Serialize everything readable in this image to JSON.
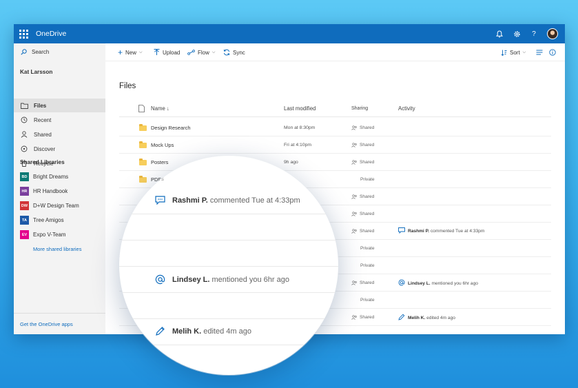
{
  "app": {
    "title": "OneDrive",
    "accent_color": "#0f6cbd",
    "suite_icons": [
      "bell-icon",
      "gear-icon",
      "help-icon",
      "avatar"
    ]
  },
  "sidebar": {
    "search_label": "Search",
    "user_name": "Kat Larsson",
    "nav": [
      {
        "label": "Files",
        "icon": "folder-icon",
        "active": true
      },
      {
        "label": "Recent",
        "icon": "clock-icon",
        "active": false
      },
      {
        "label": "Shared",
        "icon": "person-icon",
        "active": false
      },
      {
        "label": "Discover",
        "icon": "compass-icon",
        "active": false
      },
      {
        "label": "Recycle",
        "icon": "recycle-icon",
        "active": false
      }
    ],
    "libraries_header": "Shared Libraries",
    "libraries": [
      {
        "badge": "BD",
        "label": "Bright Dreams",
        "color": "#0b7a75"
      },
      {
        "badge": "HR",
        "label": "HR Handbook",
        "color": "#7a3e9d"
      },
      {
        "badge": "DW",
        "label": "D+W Design Team",
        "color": "#d13438"
      },
      {
        "badge": "TA",
        "label": "Tree Amigos",
        "color": "#1d5aa8"
      },
      {
        "badge": "EV",
        "label": "Expo V-Team",
        "color": "#e3008c"
      }
    ],
    "more_libraries": "More shared libraries",
    "get_apps": "Get the OneDrive apps"
  },
  "command_bar": {
    "new": "New",
    "upload": "Upload",
    "flow": "Flow",
    "sync": "Sync",
    "sort": "Sort"
  },
  "main": {
    "title": "Files",
    "columns": {
      "name": "Name ↓",
      "modified": "Last modified",
      "sharing": "Sharing",
      "activity": "Activity"
    },
    "rows": [
      {
        "name": "Design Research",
        "modified": "Mon at 8:30pm",
        "sharing": "Shared",
        "activity": null
      },
      {
        "name": "Mock Ups",
        "modified": "Fri at 4:10pm",
        "sharing": "Shared",
        "activity": null
      },
      {
        "name": "Posters",
        "modified": "9h ago",
        "sharing": "Shared",
        "activity": null
      },
      {
        "name": "PDFs",
        "modified": "",
        "sharing": "Private",
        "activity": null
      },
      {
        "name": "",
        "modified": "",
        "sharing": "Shared",
        "activity": null
      },
      {
        "name": "",
        "modified": "",
        "sharing": "Shared",
        "activity": null
      },
      {
        "name": "",
        "modified": "",
        "sharing": "Shared",
        "activity": {
          "icon": "comment-icon",
          "user": "Rashmi P.",
          "text": "commented Tue at 4:33pm"
        }
      },
      {
        "name": "",
        "modified": "",
        "sharing": "Private",
        "activity": null
      },
      {
        "name": "",
        "modified": "",
        "sharing": "Private",
        "activity": null
      },
      {
        "name": "",
        "modified": "",
        "sharing": "Shared",
        "activity": {
          "icon": "at-icon",
          "user": "Lindsey L.",
          "text": "mentioned you 6hr ago"
        }
      },
      {
        "name": "",
        "modified": "",
        "sharing": "Private",
        "activity": null
      },
      {
        "name": "",
        "modified": "",
        "sharing": "Shared",
        "activity": {
          "icon": "pencil-icon",
          "user": "Melih K.",
          "text": "edited 4m ago"
        }
      }
    ]
  },
  "magnifier": {
    "items": [
      {
        "icon": "comment-icon",
        "user": "Rashmi P.",
        "text": "commented Tue at 4:33pm"
      },
      {
        "icon": "at-icon",
        "user": "Lindsey L.",
        "text": "mentioned you 6hr ago"
      },
      {
        "icon": "pencil-icon",
        "user": "Melih K.",
        "text": "edited 4m ago"
      }
    ]
  }
}
